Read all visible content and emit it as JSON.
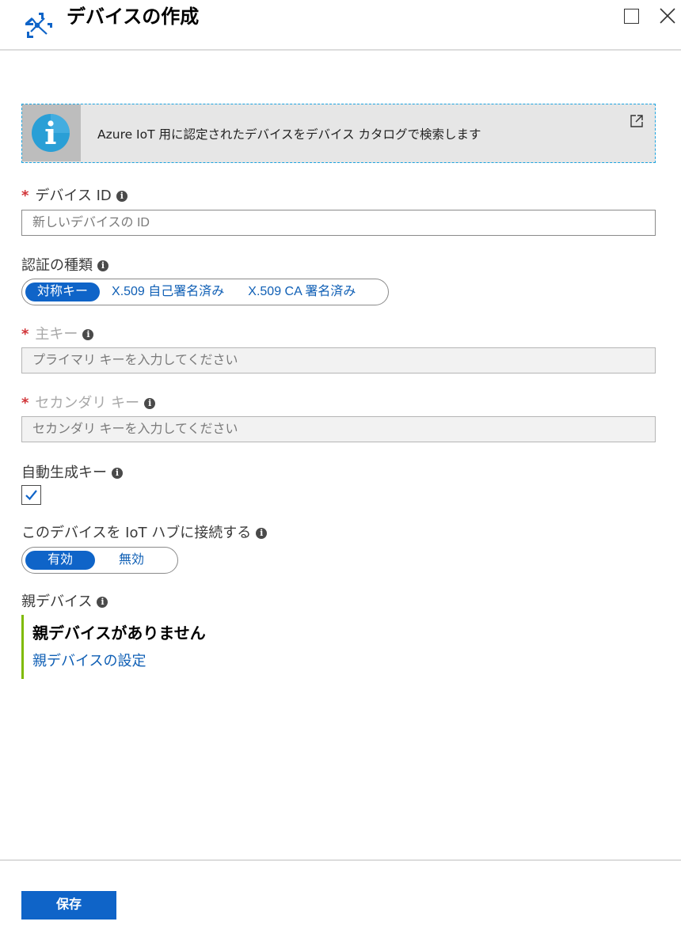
{
  "header": {
    "title": "デバイスの作成",
    "icon": "iot-device-icon"
  },
  "banner": {
    "text": "Azure IoT 用に認定されたデバイスをデバイス カタログで検索します",
    "icon": "info-icon",
    "link_icon": "external-link-icon"
  },
  "device_id": {
    "label": "デバイス ID",
    "placeholder": "新しいデバイスの ID",
    "required_mark": "*"
  },
  "auth_type": {
    "label": "認証の種類",
    "options": [
      "対称キー",
      "X.509 自己署名済み",
      "X.509 CA 署名済み"
    ],
    "selected": "対称キー"
  },
  "primary_key": {
    "label": "主キー",
    "placeholder": "プライマリ キーを入力してください",
    "required_mark": "*"
  },
  "secondary_key": {
    "label": "セカンダリ キー",
    "placeholder": "セカンダリ キーを入力してください",
    "required_mark": "*"
  },
  "auto_generate": {
    "label": "自動生成キー",
    "checked": true
  },
  "connect_hub": {
    "label": "このデバイスを IoT ハブに接続する",
    "options": [
      "有効",
      "無効"
    ],
    "selected": "有効"
  },
  "parent_device": {
    "label": "親デバイス",
    "none_text": "親デバイスがありません",
    "link_text": "親デバイスの設定"
  },
  "footer": {
    "save_label": "保存"
  },
  "colors": {
    "accent": "#0f64c8",
    "required": "#d13438",
    "parent_bar": "#7fba00",
    "banner_border": "#1aa3e0"
  }
}
